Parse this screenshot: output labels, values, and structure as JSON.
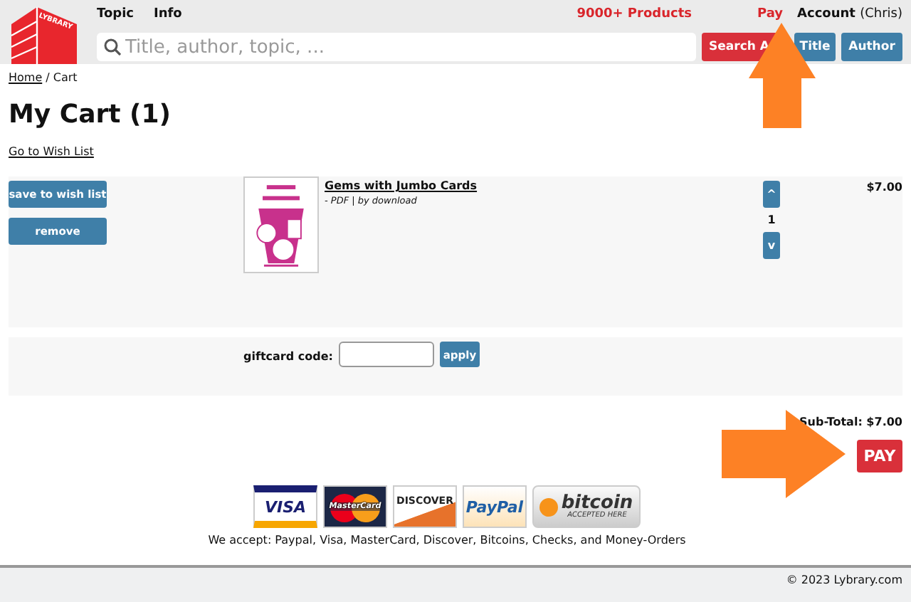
{
  "header": {
    "logo": "LYBRARY",
    "nav": [
      "Topic",
      "Info"
    ],
    "products": "9000+ Products",
    "pay_link": "Pay",
    "account": {
      "label": "Account",
      "user": "(Chris)"
    },
    "search": {
      "placeholder": "Title, author, topic, ..."
    },
    "search_buttons": [
      {
        "label": "Search A",
        "kind": "primary"
      },
      {
        "label": "Title",
        "kind": "secondary"
      },
      {
        "label": "Author",
        "kind": "secondary"
      }
    ]
  },
  "breadcrumb": {
    "items": [
      {
        "label": "Home",
        "link": true
      },
      {
        "label": "Cart",
        "link": false
      }
    ],
    "separator": "/"
  },
  "title": "My Cart (1)",
  "wish_list_link": "Go to Wish List",
  "cart_items": [
    {
      "actions": [
        "save to wish list",
        "remove"
      ],
      "image": {
        "kind": "picture"
      },
      "title": "Gems with Jumbo Cards",
      "format": "- PDF | by download",
      "qty_up": "^",
      "quantity": "1",
      "qty_down": "v",
      "price": "$7.00"
    }
  ],
  "giftcard": {
    "label": "giftcard code:",
    "button": "apply"
  },
  "subtotal": "Sub-Total: $7.00",
  "pay_button": "PAY",
  "payment_logos": [
    {
      "kind": "visa",
      "text": "VISA"
    },
    {
      "kind": "mastercard",
      "text": "MasterCard"
    },
    {
      "kind": "discover",
      "text": "DISCOVER"
    },
    {
      "kind": "paypal",
      "text": "PayPal"
    },
    {
      "kind": "bitcoin",
      "text": "bitcoin",
      "subtext": "ACCEPTED HERE"
    }
  ],
  "accept_note": "We accept: Paypal, Visa, MasterCard, Discover, Bitcoins, Checks, and Money-Orders",
  "footer": "© 2023 Lybrary.com",
  "annotations": [
    {
      "kind": "up-arrow"
    },
    {
      "kind": "right-arrow"
    }
  ]
}
